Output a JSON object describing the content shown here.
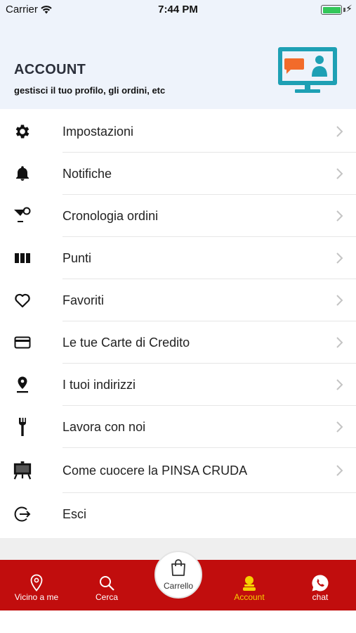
{
  "status_bar": {
    "carrier": "Carrier",
    "time": "7:44 PM",
    "battery_level": 1.0
  },
  "header": {
    "title": "ACCOUNT",
    "subtitle": "gestisci il tuo profilo, gli ordini, etc",
    "illustration": "computer-profile-icon"
  },
  "menu": {
    "items": [
      {
        "label": "Impostazioni",
        "icon": "gear-icon"
      },
      {
        "label": "Notifiche",
        "icon": "bell-icon"
      },
      {
        "label": "Cronologia ordini",
        "icon": "cocktail-icon"
      },
      {
        "label": "Punti",
        "icon": "columns-icon"
      },
      {
        "label": "Favoriti",
        "icon": "heart-icon"
      },
      {
        "label": "Le tue Carte di Credito",
        "icon": "credit-card-icon"
      },
      {
        "label": "I tuoi indirizzi",
        "icon": "location-pin-icon"
      },
      {
        "label": "Lavora con noi",
        "icon": "fork-icon"
      },
      {
        "label": "Come cuocere la PINSA CRUDA",
        "icon": "easel-icon"
      },
      {
        "label": "Esci",
        "icon": "logout-icon"
      }
    ]
  },
  "tabbar": {
    "tabs": [
      {
        "label": "Vicino a me",
        "icon": "location-pin-icon"
      },
      {
        "label": "Cerca",
        "icon": "search-icon"
      },
      {
        "label": "Carrello",
        "icon": "shopping-bag-icon"
      },
      {
        "label": "Account",
        "icon": "user-icon",
        "active": true
      },
      {
        "label": "chat",
        "icon": "whatsapp-icon"
      }
    ]
  },
  "colors": {
    "header_bg": "#eef3fb",
    "tabbar_bg": "#c10d0d",
    "active_tab": "#f6d000",
    "illustration_teal": "#1ea0b4",
    "illustration_orange": "#f26b2a"
  }
}
